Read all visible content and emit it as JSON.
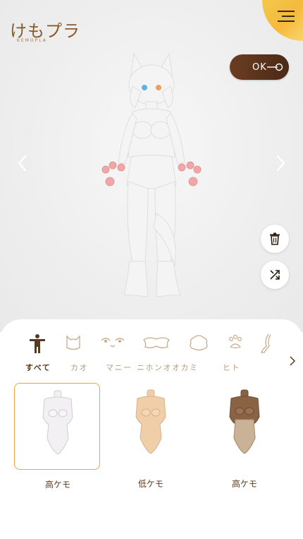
{
  "header": {
    "logo_text": "けもプラ",
    "logo_sub": "KEMOPLA",
    "menu_icon": "hamburger-menu-icon",
    "ok_label": "OK",
    "accent_color": "#f6b93b",
    "ok_color": "#5a321b"
  },
  "stage": {
    "prev_icon": "chevron-left-icon",
    "next_icon": "chevron-right-icon",
    "delete_icon": "trash-icon",
    "random_icon": "shuffle-icon"
  },
  "categories": [
    {
      "label": "すべて",
      "icon": "body-icon",
      "active": true
    },
    {
      "label": "カオ",
      "icon": "cat-face-icon",
      "active": false
    },
    {
      "label": "マニー",
      "icon": "eyes-icon",
      "active": false
    },
    {
      "label": "ニホンオオカミ",
      "icon": "wolf-head-icon",
      "active": false
    },
    {
      "label": "ヒト",
      "icon": "human-head-icon",
      "active": false
    },
    {
      "label": "",
      "icon": "paw-icon",
      "active": false
    },
    {
      "label": "",
      "icon": "leg-icon",
      "active": false
    }
  ],
  "parts": [
    {
      "label": "高ケモ",
      "color": "#f2f0f2",
      "selected": true
    },
    {
      "label": "低ケモ",
      "color": "#f0cfa8",
      "selected": false
    },
    {
      "label": "高ケモ",
      "color": "#8a6244",
      "selected": false
    }
  ]
}
